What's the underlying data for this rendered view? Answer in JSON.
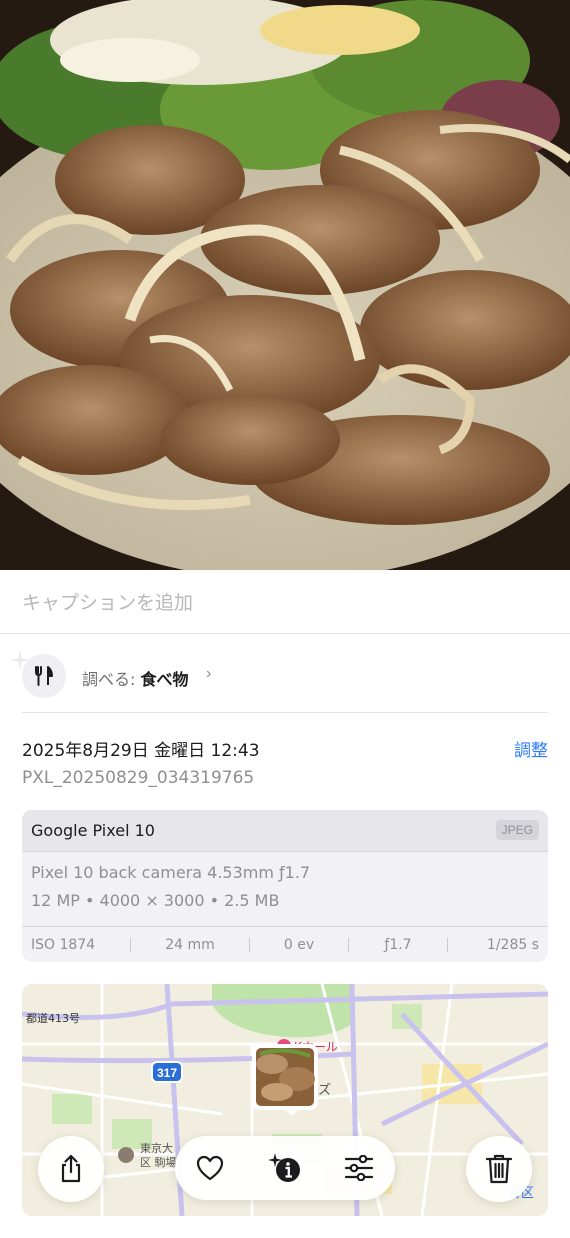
{
  "caption": {
    "placeholder": "キャプションを追加"
  },
  "lookup": {
    "prefix": "調べる:",
    "subject": "食べ物",
    "chevron": "›"
  },
  "info": {
    "datetime": "2025年8月29日 金曜日 12:43",
    "adjust_label": "調整",
    "filename": "PXL_20250829_034319765"
  },
  "camera": {
    "device": "Google Pixel 10",
    "format": "JPEG",
    "lens": "Pixel 10 back camera 4.53mm ƒ1.7",
    "specs": "12 MP • 4000 × 3000 • 2.5 MB",
    "exif": {
      "iso": "ISO 1874",
      "focal": "24 mm",
      "ev": "0 ev",
      "aperture": "ƒ1.7",
      "shutter": "1/285 s"
    }
  },
  "map": {
    "road_label": "都道413号",
    "route_badge": "317",
    "poi_hall": "Kホール",
    "poi_uni": "東京大",
    "poi_ward": "区 駒場",
    "poi_z": "ズ",
    "corner_label": "谷区"
  },
  "toolbar": {
    "share_icon": "share-icon",
    "favorite_icon": "heart-icon",
    "info_icon": "sparkle-info-icon",
    "adjust_icon": "sliders-icon",
    "delete_icon": "trash-icon"
  },
  "colors": {
    "accent": "#2f7cf6"
  }
}
